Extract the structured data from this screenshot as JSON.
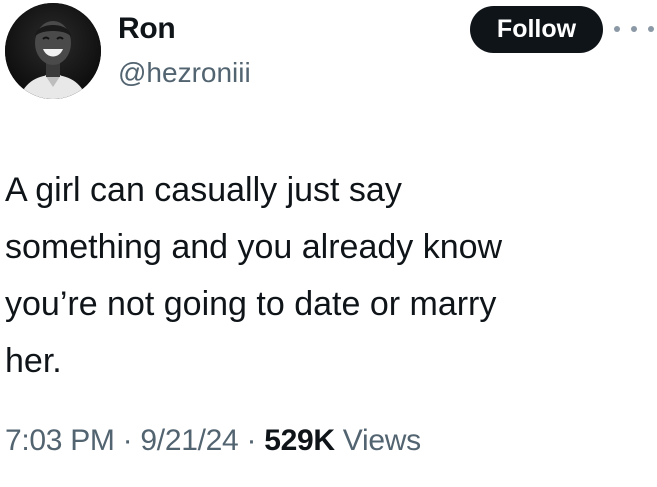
{
  "author": {
    "name": "Ron",
    "handle": "@hezroniii",
    "avatar": "avatar-photo"
  },
  "actions": {
    "follow_label": "Follow",
    "more_icon": "more-horizontal-icon"
  },
  "tweet": {
    "lines": [
      "A girl can casually just say",
      "something and you already know",
      "you’re not going to date or marry",
      "her."
    ]
  },
  "meta": {
    "time": "7:03 PM",
    "separator": "·",
    "date": "9/21/24",
    "views_count": "529K",
    "views_label": "Views"
  },
  "colors": {
    "text_primary": "#0f1419",
    "text_secondary": "#536471",
    "button_bg": "#0f1419",
    "button_text": "#ffffff"
  }
}
